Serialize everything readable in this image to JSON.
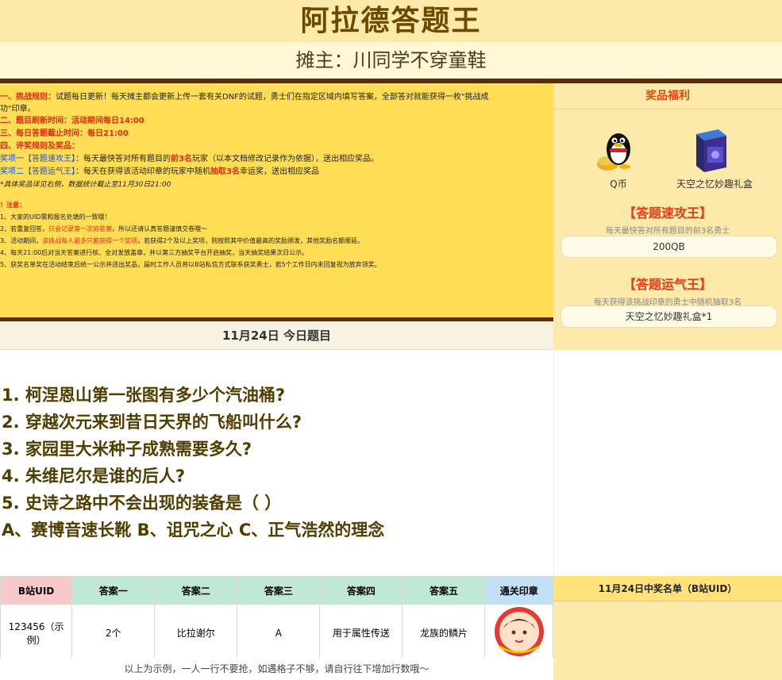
{
  "header": {
    "title": "阿拉德答题王",
    "host": "摊主：川同学不穿童鞋"
  },
  "rules": {
    "r1_label": "一、挑战规则：",
    "r1_text": "试题每日更新！每天摊主都会更新上传一套有关DNF的试题，勇士们在指定区域内填写答案，全部答对就能获得一枚\"挑战成",
    "r1_cont": "功\"印章。",
    "r2": "二、题目刷新时间：活动期间每日14:00",
    "r3": "三、每日答题截止时间：每日21:00",
    "r4": "四、评奖规则及奖品：",
    "a1_label": "奖项一【答题速攻王】",
    "a1_text_pre": "：每天最快答对所有题目的",
    "a1_highlight": "前3名",
    "a1_text_post": "玩家（以本文档修改记录作为依据），送出相应奖品。",
    "a2_label": "奖项二【答题运气王】",
    "a2_text_pre": "：每天在获得该活动印章的玩家中随机",
    "a2_highlight": "抽取3名",
    "a2_text_post": "幸运奖，送出相应奖品",
    "footnote": "*具体奖品详见右侧，数据统计截止至11月30日21:00",
    "notice_label": "！注意：",
    "n1": "1、大家的UID需和报名处填的一致哦！",
    "n2_pre": "2、若重复回答，",
    "n2_red": "只会记录第一次的答案",
    "n2_post": "，所以还请认真答题谨慎交卷哦～",
    "n3_pre": "3、活动期间，",
    "n3_red": "该挑战每人最多只能获得一个奖项",
    "n3_post": "，若获得2个及以上奖项，则按照其中价值最高的奖励颁发，其他奖励名额顺延。",
    "n4": "4、每天21:00后对当天答案进行核、全对发放盖章，并以第三方抽奖平台开启抽奖，当天抽奖结果次日公示。",
    "n5": "5、获奖名单奖在活动结束后统一公示并送出奖品，届时工作人员将以B站私信方式联系获奖勇士，若5个工作日内未回复视为放弃领奖。"
  },
  "prizes": {
    "heading": "奖品福利",
    "p1_name": "Q币",
    "p2_name": "天空之忆妙趣礼盒",
    "award1_title": "【答题速攻王】",
    "award1_desc": "每天最快答对所有题目的前3名勇士",
    "award1_prize": "200QB",
    "award2_title": "【答题运气王】",
    "award2_desc": "每天获得该挑战印章的勇士中随机抽取3名",
    "award2_prize": "天空之忆妙趣礼盒*1"
  },
  "day": {
    "heading": "11月24日 今日题目",
    "questions": [
      "1.  柯涅恩山第一张图有多少个汽油桶?",
      "2.  穿越次元来到昔日天界的飞船叫什么?",
      "3.  家园里大米种子成熟需要多久?",
      "4.  朱维尼尔是谁的后人?",
      "5.   史诗之路中不会出现的装备是（ ）",
      "A、赛博音速长靴   B、诅咒之心  C、正气浩然的理念"
    ]
  },
  "table": {
    "headers": [
      "B站UID",
      "答案一",
      "答案二",
      "答案三",
      "答案四",
      "答案五",
      "通关印章"
    ],
    "example": [
      "123456（示例）",
      "2个",
      "比拉谢尔",
      "A",
      "用于属性传送",
      "龙族的鳞片"
    ],
    "note": "以上为示例，一人一行不要抢，如遇格子不够，请自行往下增加行数哦～",
    "colors": [
      "#f7c8c8",
      "#bfe9d4",
      "#bfe9d4",
      "#bfe9d4",
      "#bfe9d4",
      "#bfe9d4",
      "#bfe0f5"
    ]
  },
  "winners": {
    "heading": "11月24日中奖名单（B站UID）"
  }
}
